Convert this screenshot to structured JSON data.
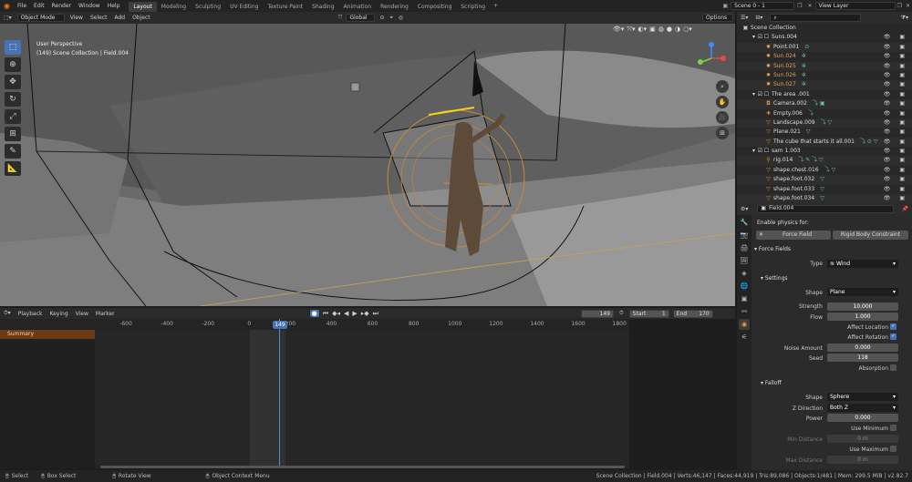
{
  "topbar": {
    "menus": [
      "File",
      "Edit",
      "Render",
      "Window",
      "Help"
    ],
    "workspaces": [
      "Layout",
      "Modeling",
      "Sculpting",
      "UV Editing",
      "Texture Paint",
      "Shading",
      "Animation",
      "Rendering",
      "Compositing",
      "Scripting"
    ],
    "active_workspace": "Layout",
    "add_tab": "+",
    "scene": "Scene 0 - 1",
    "view_layer": "View Layer"
  },
  "viewport_header": {
    "mode": "Object Mode",
    "menus": [
      "View",
      "Select",
      "Add",
      "Object"
    ],
    "transform": "Global",
    "options": "Options"
  },
  "viewport": {
    "info_line1": "User Perspective",
    "info_line2": "(149) Scene Collection | Field.004"
  },
  "timeline": {
    "menus": [
      "Playback",
      "Keying",
      "View",
      "Marker"
    ],
    "current_frame": "149",
    "start_label": "Start",
    "start": "1",
    "end_label": "End",
    "end": "170",
    "ticks": [
      "-600",
      "-400",
      "-200",
      "0",
      "200",
      "400",
      "600",
      "800",
      "1000",
      "1200",
      "1400",
      "1600",
      "1800"
    ],
    "summary": "Summary"
  },
  "outliner": {
    "root": "Scene Collection",
    "rows": [
      {
        "name": "Suns.004",
        "icon": "collection",
        "indent": 1,
        "icons": ""
      },
      {
        "name": "Point.001",
        "icon": "light",
        "indent": 2,
        "icons": "⊙"
      },
      {
        "name": "Sun.024",
        "icon": "light",
        "indent": 2,
        "icons": "✲"
      },
      {
        "name": "Sun.025",
        "icon": "light",
        "indent": 2,
        "icons": "✲"
      },
      {
        "name": "Sun.026",
        "icon": "light",
        "indent": 2,
        "icons": "✲"
      },
      {
        "name": "Sun.027",
        "icon": "light",
        "indent": 2,
        "icons": "✲"
      },
      {
        "name": "The area .001",
        "icon": "collection",
        "indent": 1,
        "icons": ""
      },
      {
        "name": "Camera.002",
        "icon": "camera",
        "indent": 2,
        "icons": "⤵ ▣"
      },
      {
        "name": "Empty.006",
        "icon": "empty",
        "indent": 2,
        "icons": "⤵"
      },
      {
        "name": "Landscape.009",
        "icon": "mesh",
        "indent": 2,
        "icons": "⤵ ▽"
      },
      {
        "name": "Plane.021",
        "icon": "mesh",
        "indent": 2,
        "icons": "▽"
      },
      {
        "name": "The cube that starts it all.001",
        "icon": "mesh",
        "indent": 2,
        "icons": "⤵ ⊙ ▽"
      },
      {
        "name": "sam 1.003",
        "icon": "collection",
        "indent": 1,
        "icons": ""
      },
      {
        "name": "rig.014",
        "icon": "armature",
        "indent": 2,
        "icons": "⤵ ✎ ⤵ ▽"
      },
      {
        "name": "shape.chest.016",
        "icon": "mesh",
        "indent": 2,
        "icons": "⤵ ▽"
      },
      {
        "name": "shape.foot.032",
        "icon": "mesh",
        "indent": 2,
        "icons": "▽"
      },
      {
        "name": "shape.foot.033",
        "icon": "mesh",
        "indent": 2,
        "icons": "▽"
      },
      {
        "name": "shape.foot.034",
        "icon": "mesh",
        "indent": 2,
        "icons": "▽"
      }
    ]
  },
  "properties": {
    "object_name": "Field.004",
    "enable_physics_for": "Enable physics for:",
    "force_field_btn": "Force Field",
    "rigid_body_btn": "Rigid Body Constraint",
    "force_fields_section": "Force Fields",
    "type_label": "Type",
    "type_value": "Wind",
    "settings_section": "Settings",
    "shape_label": "Shape",
    "shape_value": "Plane",
    "strength_label": "Strength",
    "strength_value": "10.000",
    "flow_label": "Flow",
    "flow_value": "1.000",
    "affect_location_label": "Affect Location",
    "affect_rotation_label": "Affect Rotation",
    "noise_amount_label": "Noise Amount",
    "noise_amount_value": "0.000",
    "seed_label": "Seed",
    "seed_value": "118",
    "absorption_label": "Absorption",
    "falloff_section": "Falloff",
    "falloff_shape_label": "Shape",
    "falloff_shape_value": "Sphere",
    "z_direction_label": "Z Direction",
    "z_direction_value": "Both Z",
    "power_label": "Power",
    "power_value": "0.000",
    "use_minimum_label": "Use Minimum",
    "min_distance_label": "Min Distance",
    "min_distance_value": "0 m",
    "use_maximum_label": "Use Maximum",
    "max_distance_label": "Max Distance",
    "max_distance_value": "0 m"
  },
  "statusbar": {
    "select": "Select",
    "box_select": "Box Select",
    "rotate_view": "Rotate View",
    "context_menu": "Object Context Menu",
    "stats": "Scene Collection | Field.004 | Verts:46,147 | Faces:44,919 | Tris:89,086 | Objects:1/481 | Mem: 299.5 MiB | v2.82.7"
  }
}
